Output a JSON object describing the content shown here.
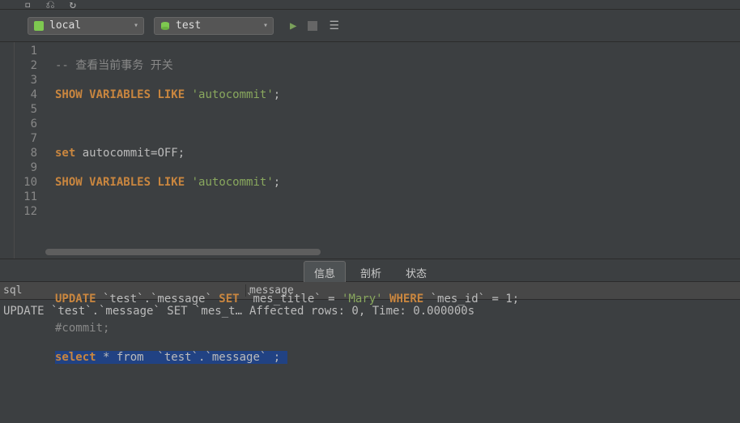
{
  "toolbar": {
    "connection": "local",
    "database": "test"
  },
  "code": {
    "lines": [
      "1",
      "2",
      "3",
      "4",
      "5",
      "6",
      "7",
      "8",
      "9",
      "10",
      "11",
      "12"
    ],
    "l1_comment": "-- 查看当前事务 开关",
    "l2": {
      "kw1": "SHOW",
      "kw2": "VARIABLES",
      "kw3": "LIKE",
      "str": "'autocommit'",
      "end": ";"
    },
    "l4": {
      "kw": "set",
      "rest": " autocommit=OFF;"
    },
    "l5": {
      "kw1": "SHOW",
      "kw2": "VARIABLES",
      "kw3": "LIKE",
      "str": "'autocommit'",
      "end": ";"
    },
    "l9": {
      "kw1": "UPDATE",
      "t1": " `test`.`message` ",
      "kw2": "SET",
      "t2": " `mes_title` = ",
      "str": "'Mary'",
      "sp": " ",
      "kw3": "WHERE",
      "t3": " `mes_id` = 1;"
    },
    "l10": "#commit;",
    "l11": {
      "kw": "select",
      "rest": " * from  `test`.`message` ;"
    }
  },
  "tabs": {
    "info": "信息",
    "profile": "剖析",
    "status": "状态"
  },
  "results": {
    "header_sql": "sql",
    "header_msg": "message",
    "row_sql": "UPDATE `test`.`message` SET `mes_title` = 'M...",
    "row_msg": "Affected rows: 0, Time: 0.000000s"
  }
}
